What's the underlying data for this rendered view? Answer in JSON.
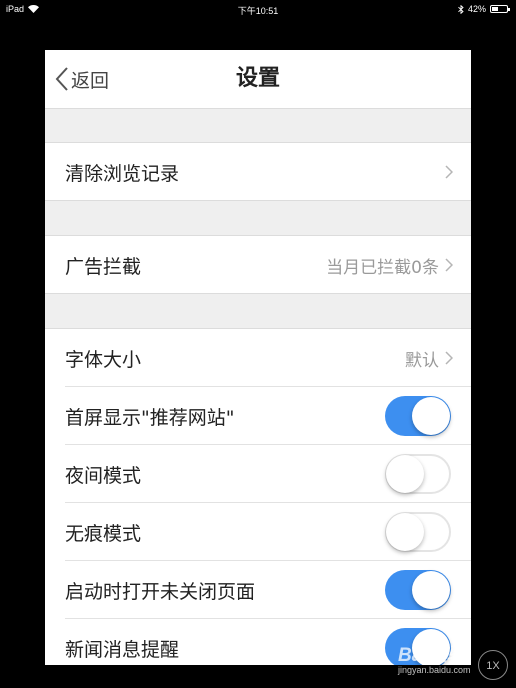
{
  "status_bar": {
    "device": "iPad",
    "time": "下午10:51",
    "battery": "42%",
    "battery_level": 0.42
  },
  "nav": {
    "back_label": "返回",
    "title": "设置"
  },
  "rows": {
    "clear_history": {
      "label": "清除浏览记录"
    },
    "ad_block": {
      "label": "广告拦截",
      "value": "当月已拦截0条"
    },
    "font_size": {
      "label": "字体大小",
      "value": "默认"
    },
    "home_recommend": {
      "label": "首屏显示\"推荐网站\"",
      "on": true
    },
    "night_mode": {
      "label": "夜间模式",
      "on": false
    },
    "private_mode": {
      "label": "无痕模式",
      "on": false
    },
    "restore_pages": {
      "label": "启动时打开未关闭页面",
      "on": true
    },
    "news_alerts": {
      "label": "新闻消息提醒",
      "on": true
    }
  },
  "colors": {
    "toggle_on": "#3d8ff0",
    "section_gap": "#efefef"
  },
  "watermark": {
    "logo": "Bai经验",
    "url": "jingyan.baidu.com",
    "badge": "1X"
  }
}
